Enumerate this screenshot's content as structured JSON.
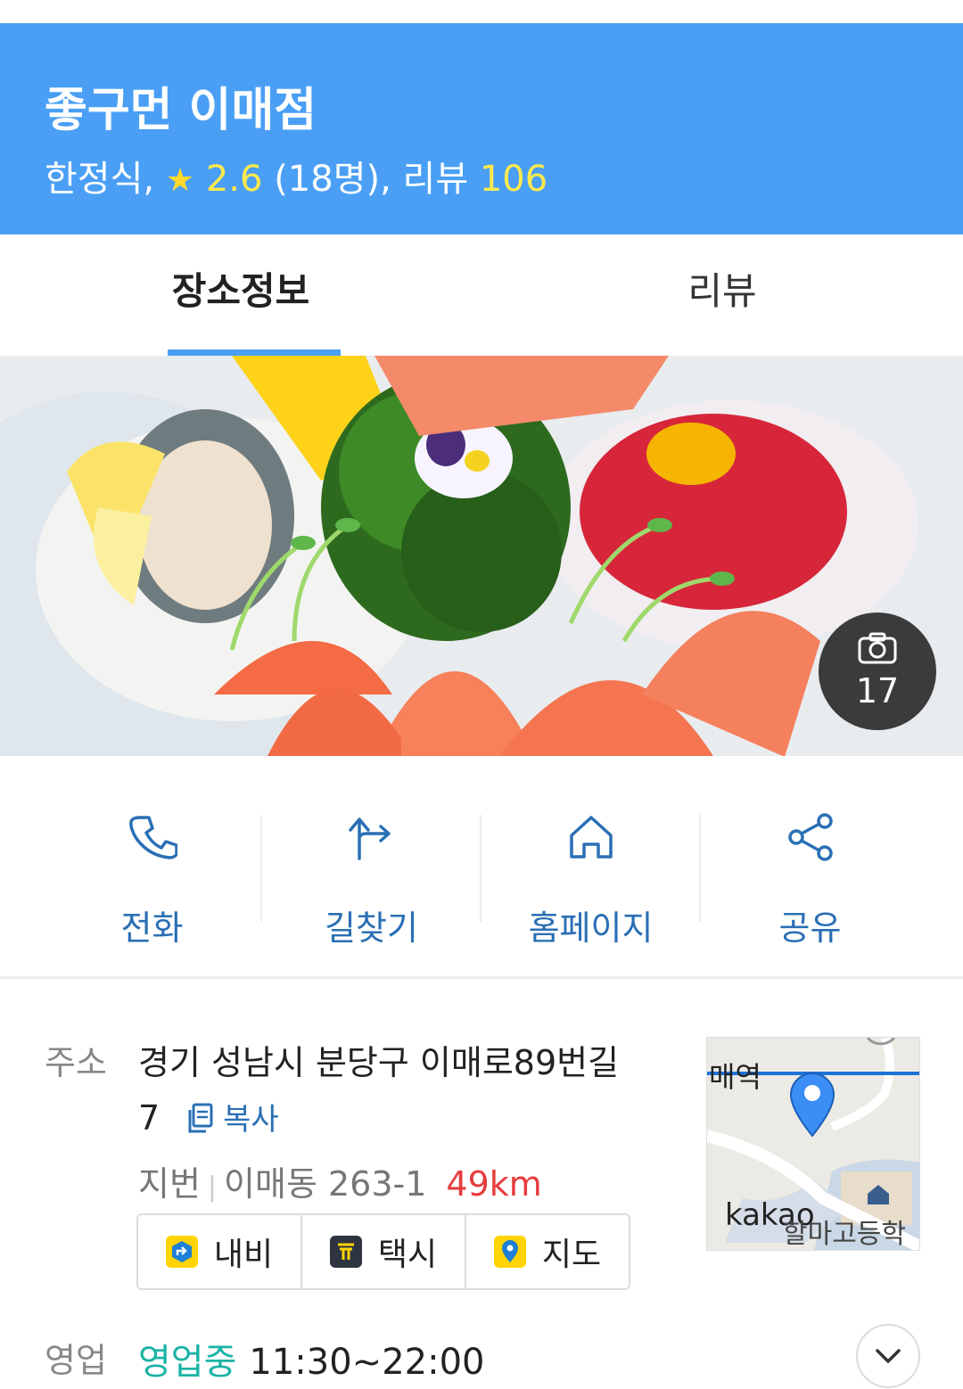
{
  "header": {
    "title": "좋구먼 이매점",
    "category": "한정식,",
    "rating": "2.6",
    "raters": "(18명),",
    "review_label": "리뷰",
    "review_count": "106"
  },
  "tabs": [
    {
      "label": "장소정보",
      "active": true
    },
    {
      "label": "리뷰",
      "active": false
    }
  ],
  "photo": {
    "count": "17"
  },
  "actions": [
    {
      "label": "전화",
      "icon": "phone-icon"
    },
    {
      "label": "길찾기",
      "icon": "route-icon"
    },
    {
      "label": "홈페이지",
      "icon": "home-icon"
    },
    {
      "label": "공유",
      "icon": "share-icon"
    }
  ],
  "address": {
    "label": "주소",
    "line1": "경기 성남시 분당구 이매로89번길",
    "line2": "7",
    "copy_label": "복사",
    "jibun_label": "지번",
    "jibun_value": "이매동 263-1",
    "distance": "49km",
    "buttons": [
      {
        "label": "내비",
        "icon": "navi-icon"
      },
      {
        "label": "택시",
        "icon": "taxi-icon"
      },
      {
        "label": "지도",
        "icon": "map-pin-icon"
      }
    ]
  },
  "map": {
    "station_text": "매역",
    "brand": "kakao",
    "school_text": "할마고등학"
  },
  "hours": {
    "label": "영업",
    "status": "영업중",
    "time": "11:30~22:00"
  },
  "colors": {
    "header_bg": "#4a9ff5",
    "accent_blue": "#2a6fb5",
    "distance_red": "#e63c3c",
    "open_teal": "#1bb3a6",
    "rating_yellow": "#ffe94d"
  }
}
